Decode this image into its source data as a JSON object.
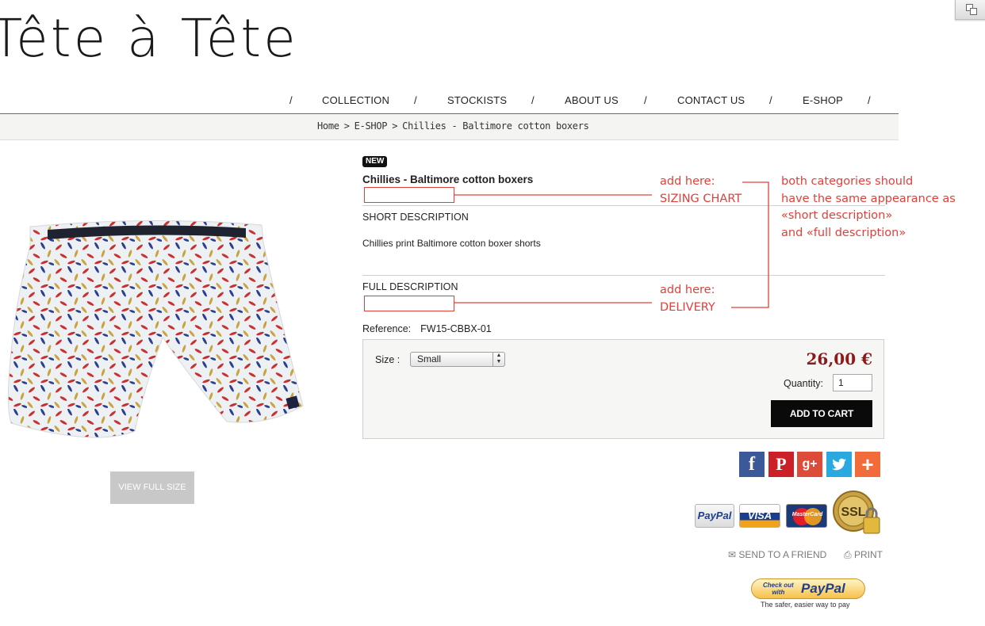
{
  "logo": {
    "text": "Tête à Tête"
  },
  "nav": {
    "separator": "/",
    "items": [
      "COLLECTION",
      "STOCKISTS",
      "ABOUT US",
      "CONTACT US",
      "E-SHOP"
    ]
  },
  "breadcrumb": {
    "separator": ">",
    "items": [
      "Home",
      "E-SHOP",
      "Chillies - Baltimore cotton boxers"
    ]
  },
  "product": {
    "badge": "NEW",
    "title": "Chillies - Baltimore cotton boxers",
    "short_description_heading": "SHORT DESCRIPTION",
    "short_description_text": "Chillies print Baltimore cotton boxer shorts",
    "full_description_heading": "FULL DESCRIPTION",
    "reference_label": "Reference:",
    "reference_value": "FW15-CBBX-01",
    "view_full_size_label": "VIEW FULL SIZE",
    "image_icon": "boxer-shorts-photo"
  },
  "buy_box": {
    "size_label": "Size :",
    "size_value": "Small",
    "price": "26,00 €",
    "quantity_label": "Quantity:",
    "quantity_value": "1",
    "add_to_cart_label": "ADD TO CART"
  },
  "social": {
    "facebook": "f",
    "pinterest": "P",
    "google": "g+",
    "twitter": "twitter-bird-icon",
    "more": "+"
  },
  "payment_badges": {
    "paypal": "PayPal",
    "visa": "VISA",
    "mastercard": "MasterCard",
    "ssl": "SSL"
  },
  "actions": {
    "send_to_friend": "SEND TO A FRIEND",
    "print": "PRINT"
  },
  "paypal_checkout": {
    "line1": "Check out",
    "line2": "with",
    "brand": "PayPal",
    "tagline": "The safer, easier way to pay"
  },
  "annotations": {
    "sizing_line1": "add here:",
    "sizing_line2": "SIZING CHART",
    "delivery_line1": "add here:",
    "delivery_line2": "DELIVERY",
    "note_lines": [
      "both categories should",
      "have the same appearance as",
      "«short description»",
      "and «full description»"
    ]
  },
  "colors": {
    "annotation_red": "#e0403a",
    "price_red": "#8b1a1a",
    "cart_button": "#0a0a0a"
  }
}
